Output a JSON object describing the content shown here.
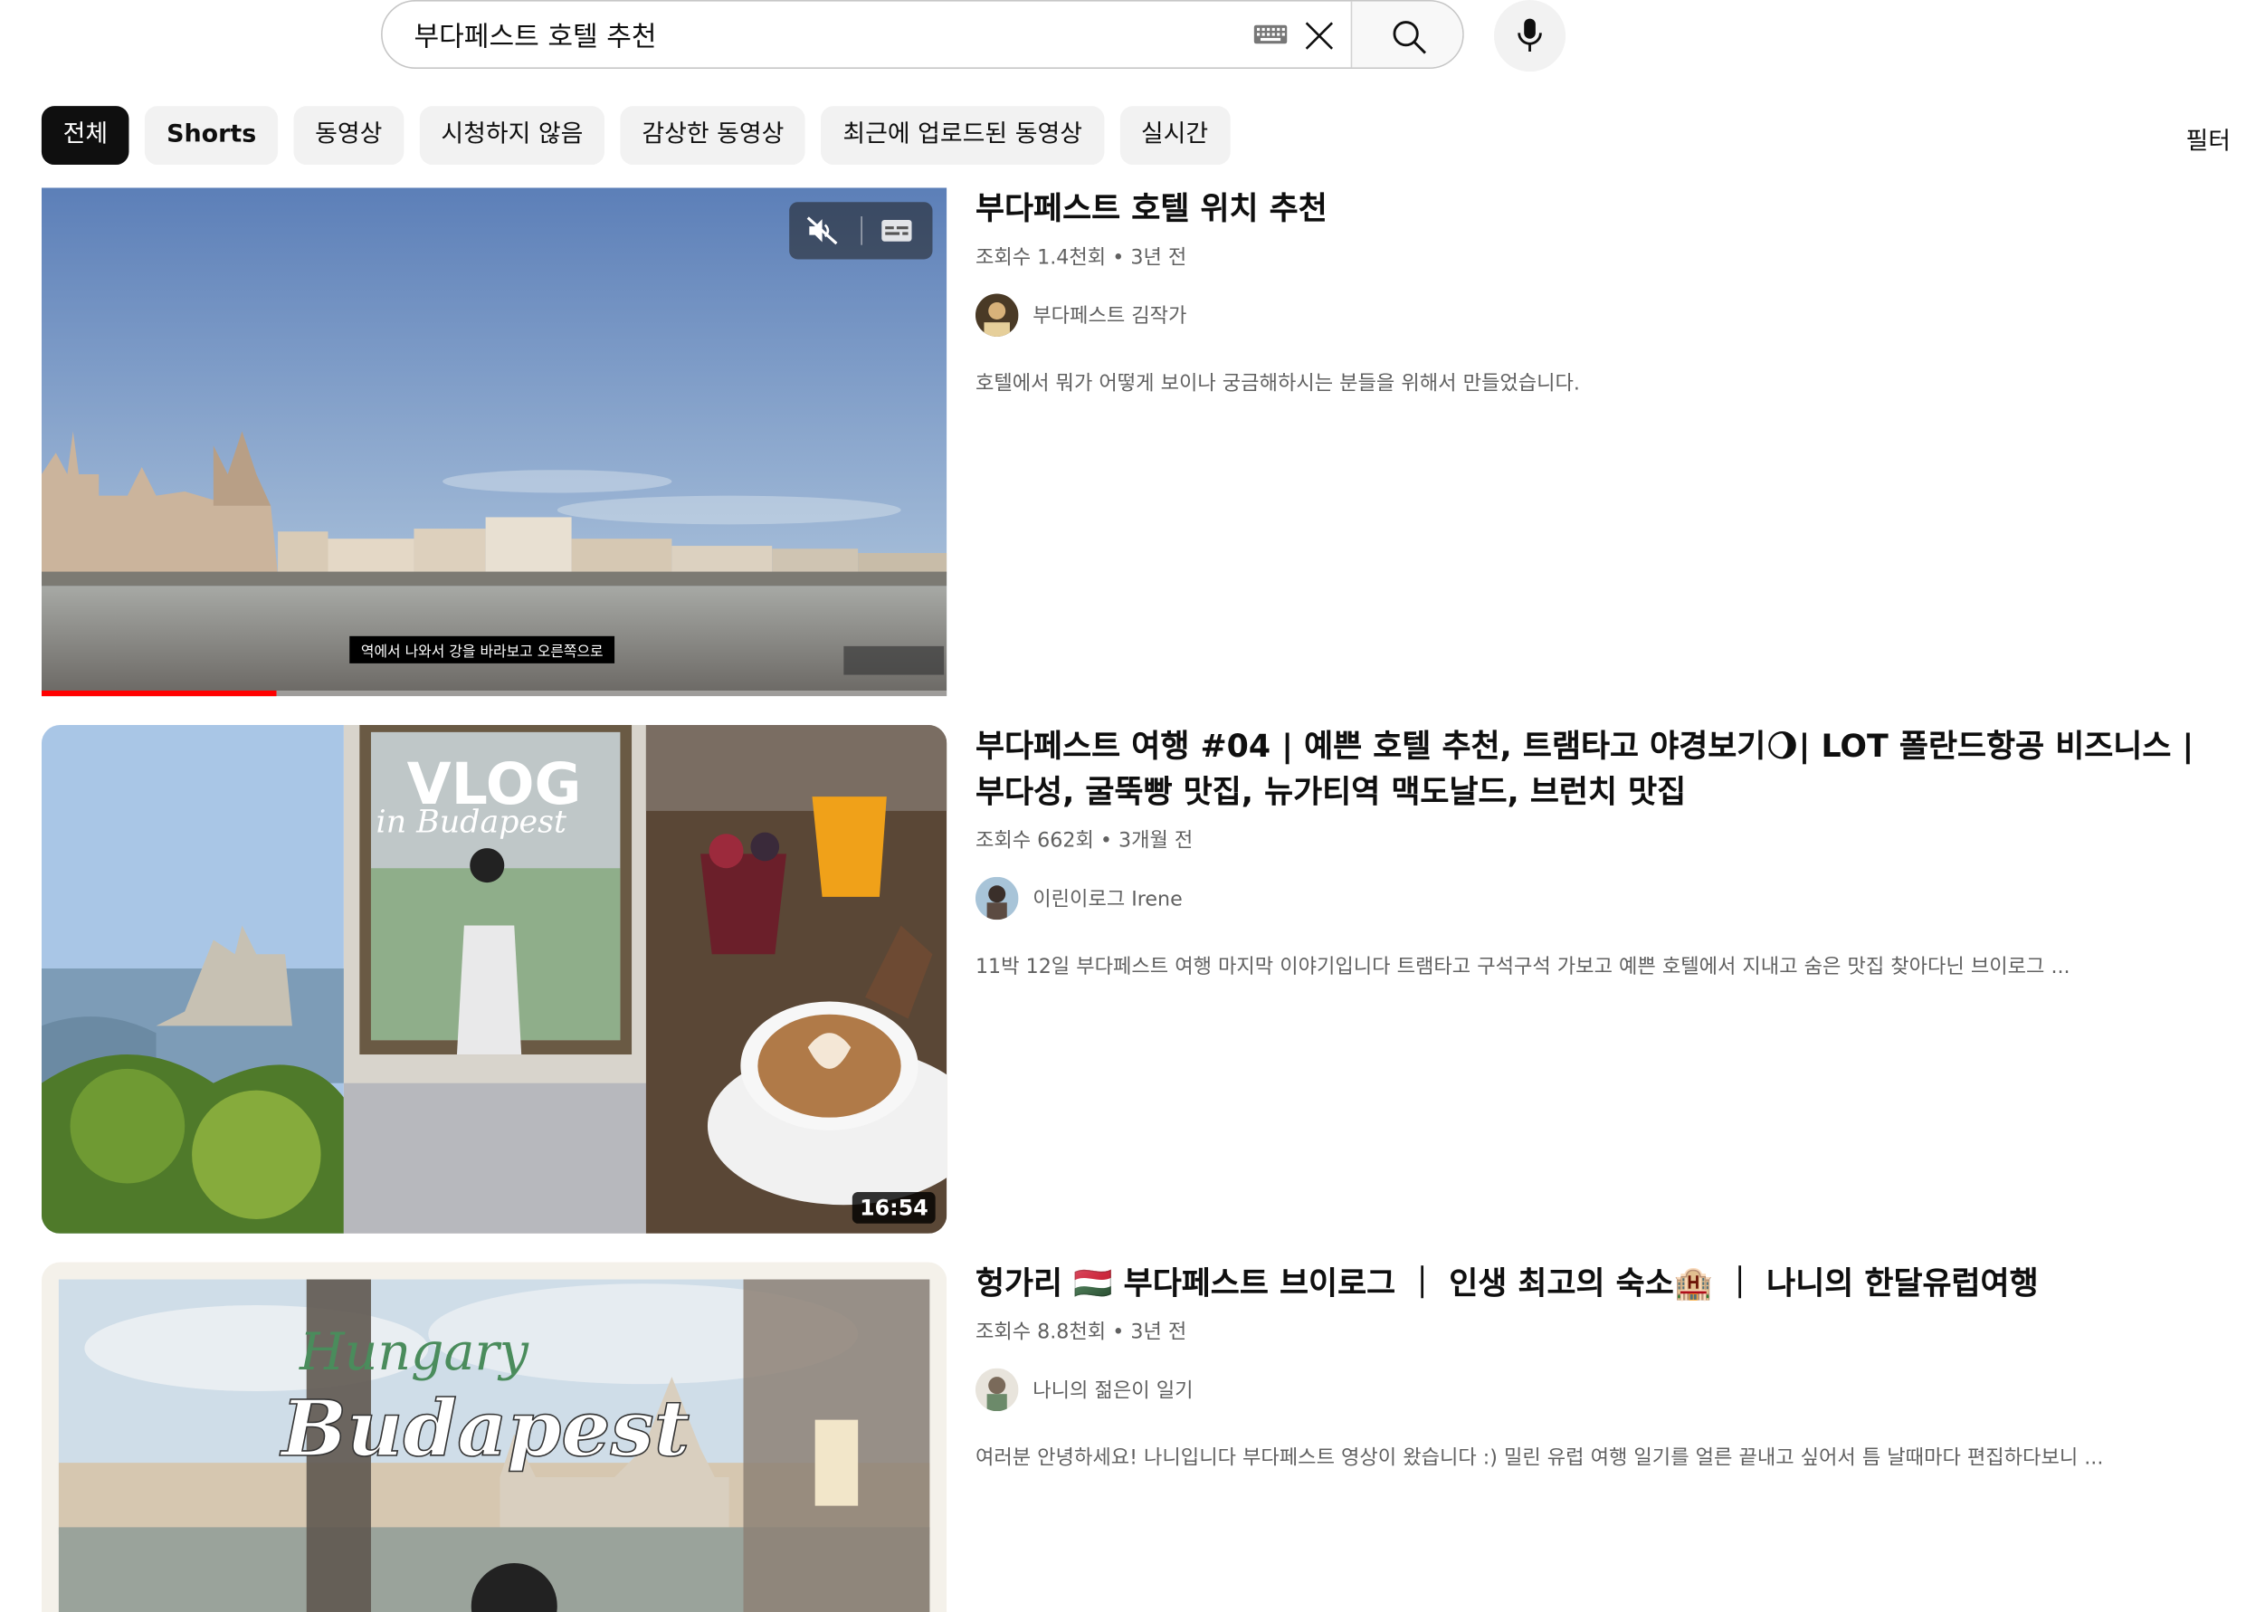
{
  "search": {
    "query": "부다페스트 호텔 추천"
  },
  "chips": [
    "전체",
    "Shorts",
    "동영상",
    "시청하지 않음",
    "감상한 동영상",
    "최근에 업로드된 동영상",
    "실시간"
  ],
  "filter_label": "필터",
  "results": [
    {
      "title": "부다페스트 호텔 위치 추천",
      "meta": "조회수 1.4천회 • 3년 전",
      "channel": "부다페스트 김작가",
      "description": "호텔에서 뭐가 어떻게 보이나 궁금해하시는 분들을 위해서 만들었습니다.",
      "caption": "역에서 나와서 강을 바라보고 오른쪽으로",
      "progress": 0.26
    },
    {
      "title": "부다페스트 여행 #04 | 예쁜 호텔 추천, 트램타고 야경보기🌖| LOT 폴란드항공 비즈니스 | 부다성, 굴뚝빵 맛집, 뉴가티역 맥도날드, 브런치 맛집",
      "meta": "조회수 662회 • 3개월 전",
      "channel": "이린이로그 Irene",
      "description": "11박 12일 부다페스트 여행 마지막 이야기입니다 트램타고 구석구석 가보고 예쁜 호텔에서 지내고 숨은 맛집 찾아다닌 브이로그 ...",
      "duration": "16:54",
      "thumb_text_1": "VLOG",
      "thumb_text_2": "in Budapest"
    },
    {
      "title": "헝가리 🇭🇺 부다페스트 브이로그 ｜ 인생 최고의 숙소🏨 ｜ 나니의 한달유럽여행",
      "meta": "조회수 8.8천회 • 3년 전",
      "channel": "나니의 젊은이 일기",
      "description": "여러분 안녕하세요! 나니입니다 부다페스트 영상이 왔습니다 :) 밀린 유럽 여행 일기를 얼른 끝내고 싶어서 틈 날때마다 편집하다보니 ...",
      "thumb_text_1": "Hungary",
      "thumb_text_2": "Budapest"
    }
  ]
}
